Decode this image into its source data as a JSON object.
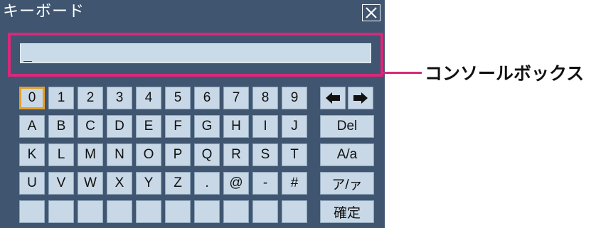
{
  "window": {
    "title": "キーボード",
    "close_icon": "close-icon"
  },
  "console": {
    "value": "_"
  },
  "keyboard": {
    "rows": [
      [
        "0",
        "1",
        "2",
        "3",
        "4",
        "5",
        "6",
        "7",
        "8",
        "9"
      ],
      [
        "A",
        "B",
        "C",
        "D",
        "E",
        "F",
        "G",
        "H",
        "I",
        "J"
      ],
      [
        "K",
        "L",
        "M",
        "N",
        "O",
        "P",
        "Q",
        "R",
        "S",
        "T"
      ],
      [
        "U",
        "V",
        "W",
        "X",
        "Y",
        "Z",
        ".",
        "@",
        "-",
        "#"
      ],
      [
        "",
        "",
        "",
        "",
        "",
        "",
        "",
        "",
        "",
        ""
      ]
    ],
    "selected_key": "0",
    "left_arrow_icon": "arrow-left-icon",
    "right_arrow_icon": "arrow-right-icon",
    "delete_label": "Del",
    "case_label": "A/a",
    "kana_label": "ア/ァ",
    "confirm_label": "確定"
  },
  "callout": {
    "label": "コンソールボックス"
  },
  "colors": {
    "window_bg": "#3f5570",
    "key_bg": "#c8d8e6",
    "highlight": "#d8287a",
    "selected": "#e2a12a"
  }
}
